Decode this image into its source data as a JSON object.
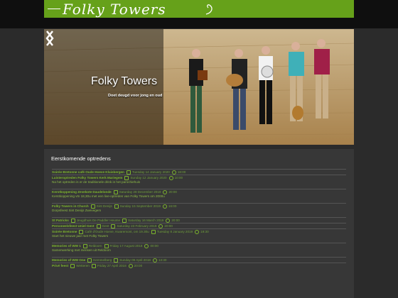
{
  "site": {
    "logo": "Folky Towers"
  },
  "hero": {
    "title": "Folky Towers",
    "subtitle": "Doet deugd voor jong en oud"
  },
  "section": {
    "title": "Eerstkomende optredens"
  },
  "events": [
    {
      "title": "Soirée Bretonne café Oude Hoeve Kluisbergen",
      "location": "",
      "date": "Tuesday 14 January 2020",
      "time": "18:00",
      "desc": "",
      "gap": 1
    },
    {
      "title": "Luisteroptreden Folky Towers Kerk Mariegem",
      "location": "",
      "date": "Sunday 12 January 2020",
      "time": "10:00",
      "desc": "Na het optreden is er de traditionele drink in het parochiehuis",
      "gap": 0
    },
    {
      "title": "Kerstkoppening Zevekote Daudelonde",
      "location": "",
      "date": "Saturday 28 December 2019",
      "time": "20:00",
      "desc": "Kerstkoppening vtn 18,30u met een live-optreden van Folky Towers om 2000u",
      "gap": 6
    },
    {
      "title": "Folky Towers in Church",
      "location": "Sint Denijs",
      "date": "Sunday 15 September 2019",
      "time": "16:00",
      "desc": "Dorpsfeest Sint Denijs Zwevegem",
      "gap": 6
    },
    {
      "title": "St Patricks",
      "location": "Jeugdhuis De Paddler Heume",
      "date": "Saturday 16 March 2019",
      "time": "20:00",
      "desc": "",
      "gap": 6
    },
    {
      "title": "Personeelsfeest Uniel Gent",
      "location": "Gent",
      "date": "Saturday 23 February 2019",
      "time": "20:00",
      "desc": "",
      "gap": 0
    },
    {
      "title": "Soirée Bretonne",
      "location": "Café d'Oude Hoeve, Kwaremont, om 19.30u",
      "date": "Tuesday 8 January 2019",
      "time": "19:30",
      "desc": "Start het nieuwe jaar met Folky Towers",
      "gap": 0
    },
    {
      "title": "Memories of WW 1",
      "location": "Reldoorn",
      "date": "Friday 17 August 2018",
      "time": "00:00",
      "desc": "Samenwerking met mensen uit Reldoorn",
      "gap": 6
    },
    {
      "title": "Memories of WW One",
      "location": "Kemmelberg",
      "date": "Sunday 09 April 2018",
      "time": "13:30",
      "desc": "",
      "gap": 6
    },
    {
      "title": "Privé feest",
      "location": "Wetteren",
      "date": "Friday 27 April 2018",
      "time": "20:00",
      "desc": "",
      "gap": 0
    }
  ],
  "colors": {
    "brand": "#66a11a",
    "link": "#7cb52c",
    "panel": "#373737"
  }
}
